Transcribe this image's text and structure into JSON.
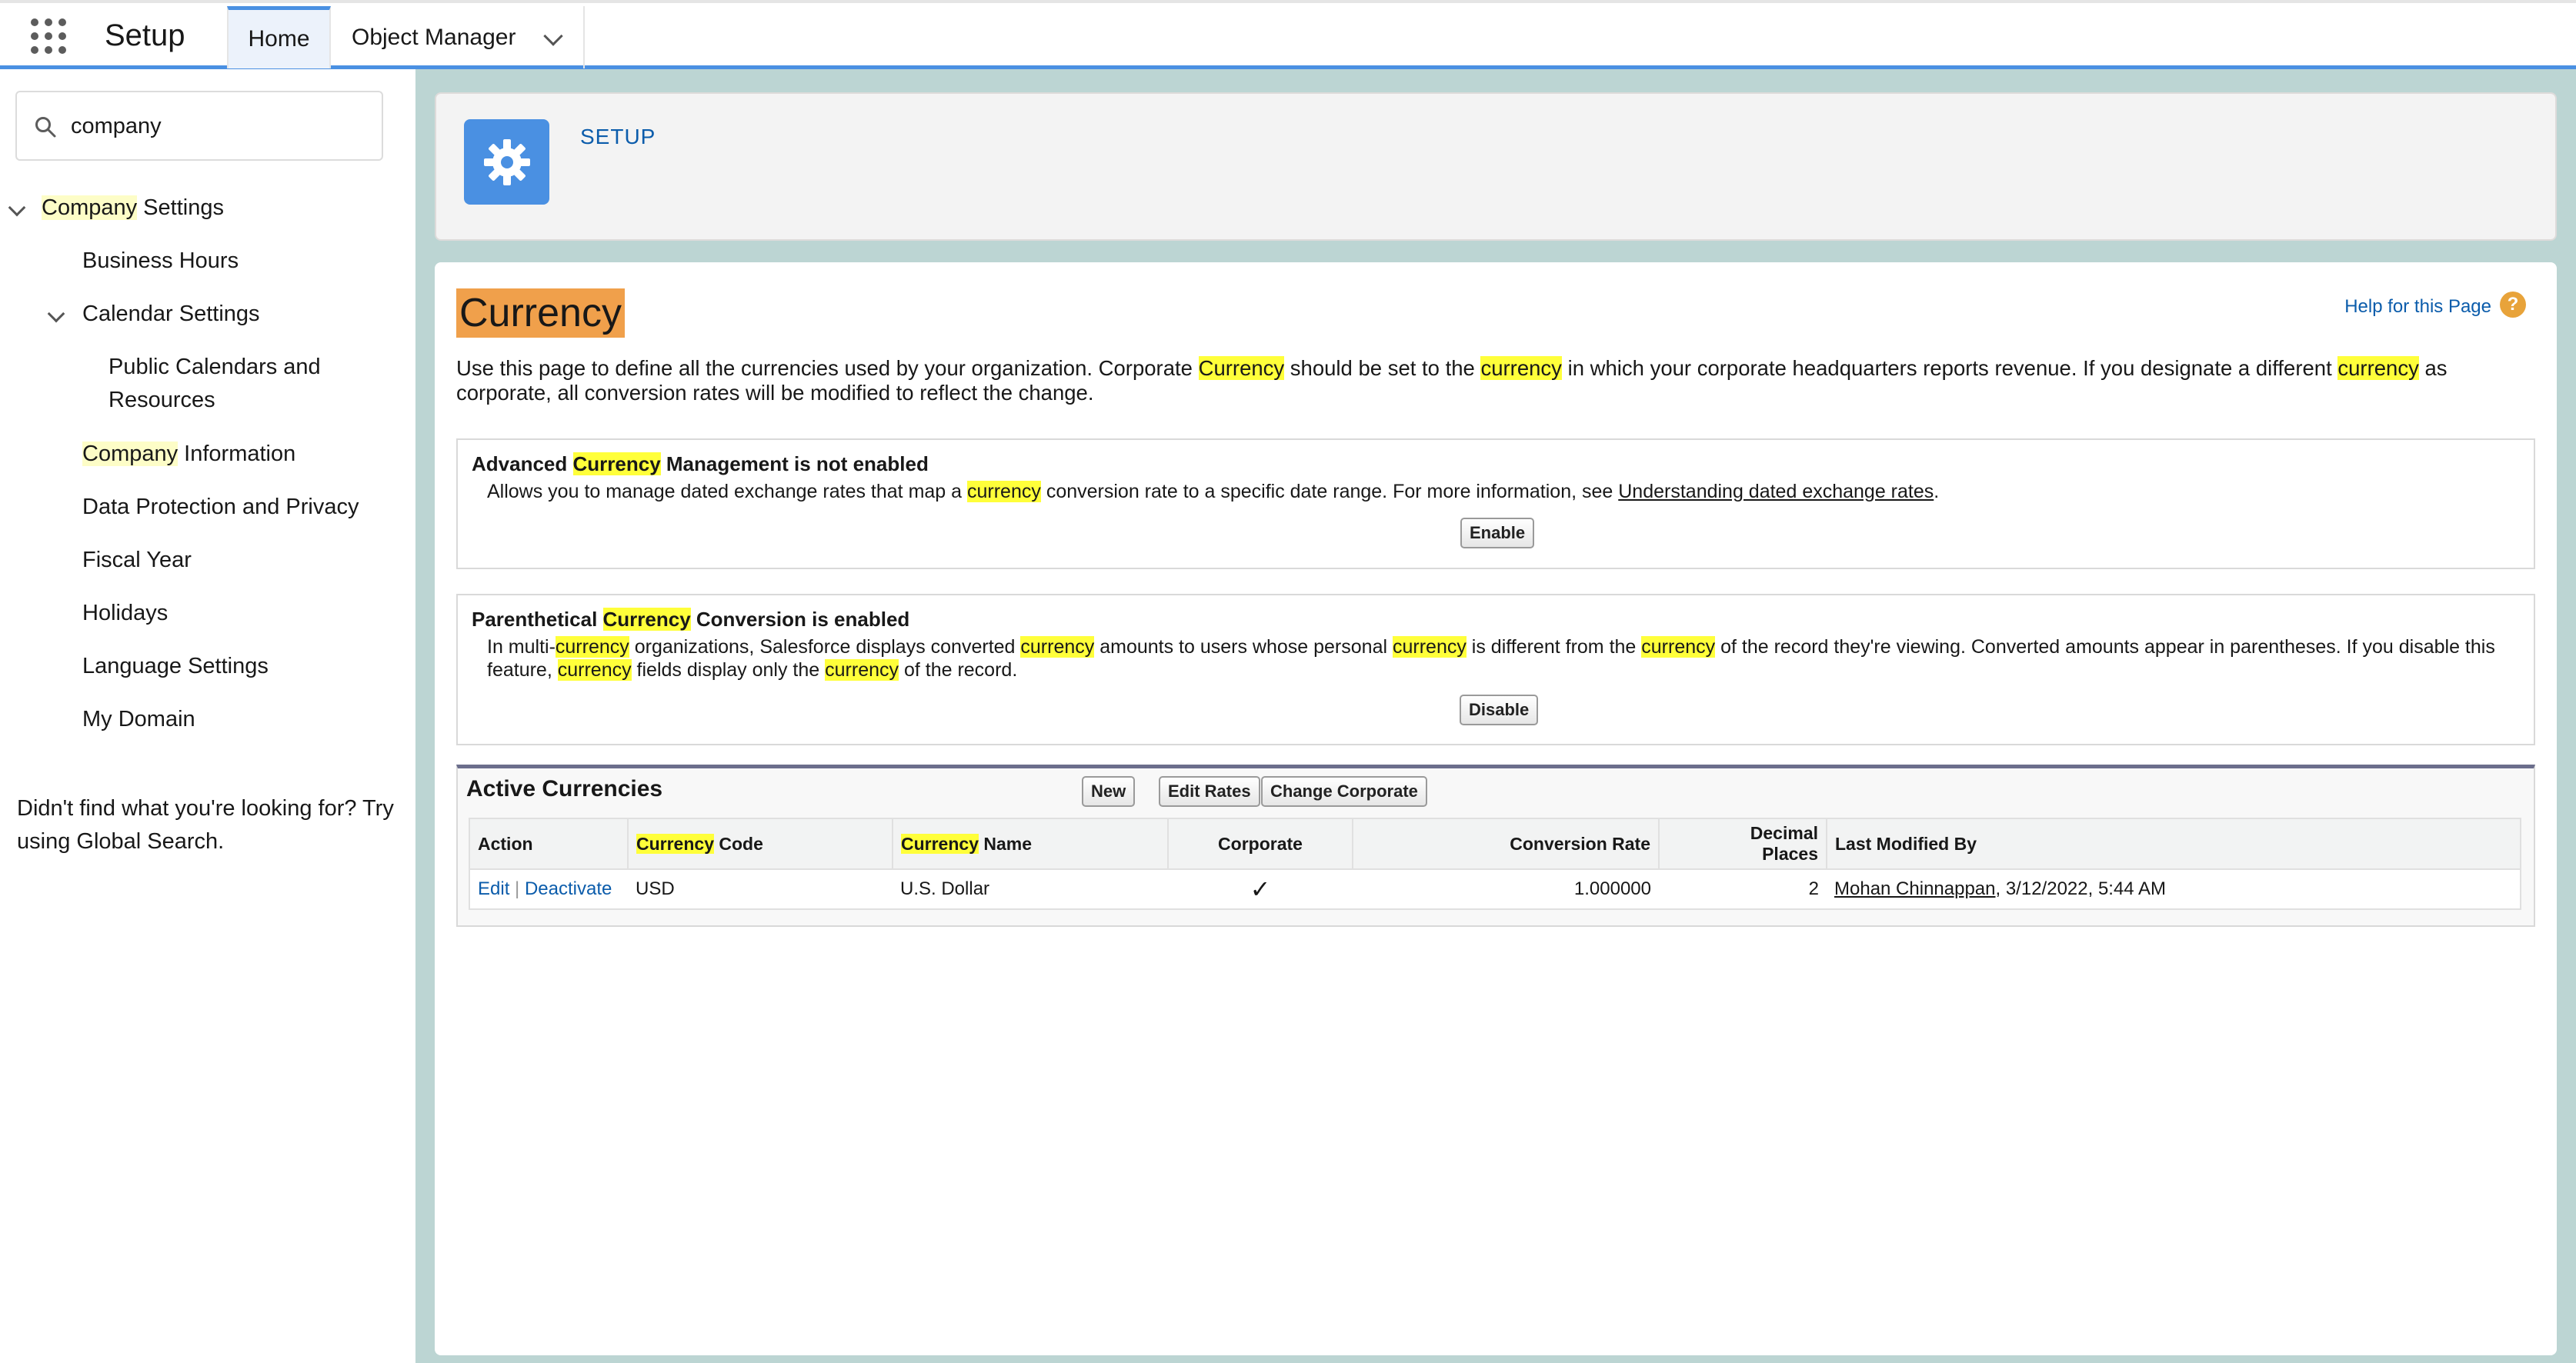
{
  "topbar": {
    "app_title": "Setup",
    "tabs": [
      {
        "label": "Home"
      },
      {
        "label": "Object Manager"
      }
    ]
  },
  "sidebar": {
    "search_value": "company",
    "items": [
      {
        "label_hl": "Company",
        "label_rest": " Settings"
      },
      {
        "label": "Business Hours"
      },
      {
        "label": "Calendar Settings"
      },
      {
        "label": "Public Calendars and Resources"
      },
      {
        "label_hl": "Company",
        "label_rest": " Information"
      },
      {
        "label": "Data Protection and Privacy"
      },
      {
        "label": "Fiscal Year"
      },
      {
        "label": "Holidays"
      },
      {
        "label": "Language Settings"
      },
      {
        "label": "My Domain"
      }
    ],
    "not_found_text": "Didn't find what you're looking for? Try using Global Search."
  },
  "header": {
    "setup_label": "SETUP",
    "gear_icon": "gear-icon"
  },
  "page": {
    "title": "Currency",
    "help_link": "Help for this Page",
    "help_badge": "?",
    "intro": {
      "p1": "Use this page to define all the currencies used by your organization. Corporate ",
      "h1": "Currency",
      "p2": " should be set to the ",
      "h2": "currency",
      "p3": " in which your corporate headquarters reports revenue. If you designate a different ",
      "h3": "currency",
      "p4": " as corporate, all conversion rates will be modified to reflect the change."
    }
  },
  "advanced": {
    "title_a": "Advanced ",
    "title_hl": "Currency",
    "title_b": " Management is not enabled",
    "desc_a": "Allows you to manage dated exchange rates that map a ",
    "desc_hl": "currency",
    "desc_b": " conversion rate to a specific date range. For more information, see ",
    "desc_link": "Understanding dated exchange rates",
    "desc_c": ".",
    "button": "Enable"
  },
  "parenthetical": {
    "title_a": "Parenthetical ",
    "title_hl": "Currency",
    "title_b": " Conversion is enabled",
    "d1": "In multi-",
    "h1": "currency",
    "d2": " organizations, Salesforce displays converted ",
    "h2": "currency",
    "d3": " amounts to users whose personal ",
    "h3": "currency",
    "d4": " is different from the ",
    "h4": "currency",
    "d5": " of the record they're viewing. Converted amounts appear in parentheses. If you disable this feature, ",
    "h5": "currency",
    "d6": " fields display only the ",
    "h6": "currency",
    "d7": " of the record.",
    "button": "Disable"
  },
  "active_currencies": {
    "title": "Active Currencies",
    "buttons": {
      "new": "New",
      "edit_rates": "Edit Rates",
      "change_corporate": "Change Corporate"
    },
    "columns": {
      "action": "Action",
      "code_hl": "Currency",
      "code_rest": " Code",
      "name_hl": "Currency",
      "name_rest": " Name",
      "corporate": "Corporate",
      "rate": "Conversion Rate",
      "decimal_1": "Decimal",
      "decimal_2": "Places",
      "modified": "Last Modified By"
    },
    "rows": [
      {
        "edit": "Edit",
        "sep": "|",
        "deactivate": "Deactivate",
        "code": "USD",
        "name": "U.S. Dollar",
        "corporate": "✓",
        "rate": "1.000000",
        "decimal": "2",
        "modified_by": "Mohan Chinnappan",
        "modified_at": ", 3/12/2022, 5:44 AM"
      }
    ]
  }
}
